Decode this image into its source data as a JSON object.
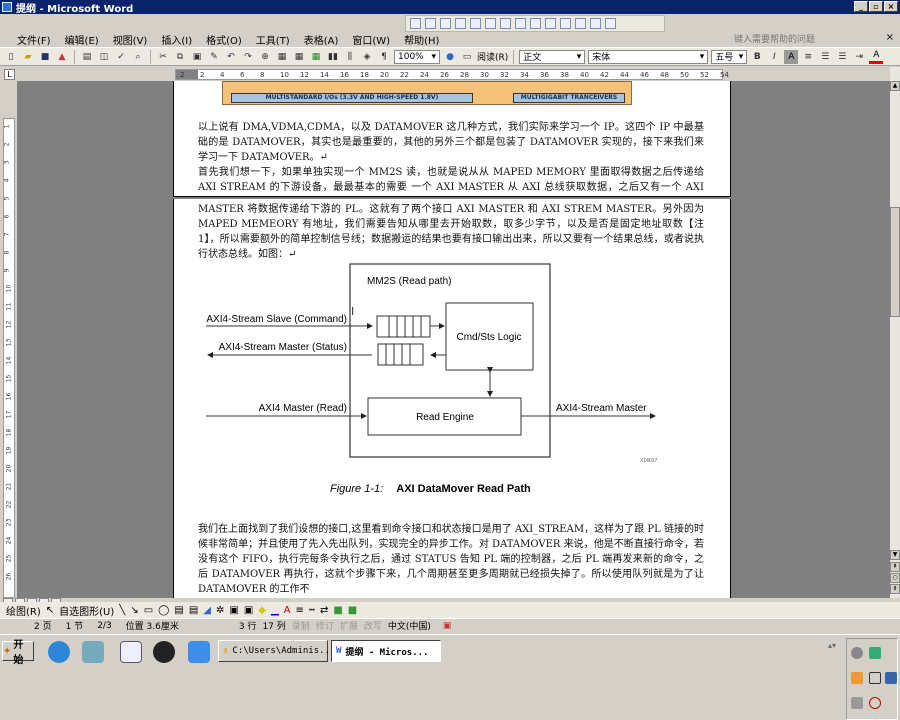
{
  "window": {
    "title": "提纲 - Microsoft Word",
    "minimize": "_",
    "restore": "▫",
    "close": "×"
  },
  "menu": {
    "items": [
      "文件(F)",
      "编辑(E)",
      "视图(V)",
      "插入(I)",
      "格式(O)",
      "工具(T)",
      "表格(A)",
      "窗口(W)",
      "帮助(H)"
    ],
    "help_placeholder": "键入需要帮助的问题",
    "help_close": "×"
  },
  "toolbar": {
    "zoom": "100%",
    "read_label": "阅读(R)",
    "style": "正文",
    "font": "宋体",
    "size": "五号",
    "bold": "B",
    "italic": "I",
    "char_shade": "A",
    "font_color_label": "A"
  },
  "ruler": {
    "ticks": [
      "2",
      "2",
      "4",
      "6",
      "8",
      "10",
      "12",
      "14",
      "16",
      "18",
      "20",
      "22",
      "24",
      "26",
      "28",
      "30",
      "32",
      "34",
      "36",
      "38",
      "40",
      "42",
      "44",
      "46",
      "48",
      "50",
      "52",
      "54"
    ],
    "vticks": [
      "1",
      "2",
      "3",
      "4",
      "5",
      "6",
      "7",
      "8",
      "9",
      "10",
      "11",
      "12",
      "13",
      "14",
      "15",
      "16",
      "17",
      "18",
      "19",
      "20",
      "21",
      "22",
      "23",
      "24",
      "25",
      "26"
    ]
  },
  "banner": {
    "left": "MULTISTANDARD I/Os (3.3V AND HIGH-SPEED 1.8V)",
    "right": "MULTIGIGABIT TRANCEIVERS"
  },
  "document": {
    "p1": "以上说有 DMA,VDMA,CDMA，以及 DATAMOVER 这几种方式，我们实际来学习一个 IP。这四个 IP 中最基础的是 DATAMOVER，其实也是最重要的，其他的另外三个都是包装了 DATAMOVER 实现的，接下来我们来学习一下 DATAMOVER。↵",
    "p2": "首先我们想一下，如果单独实现一个 MM2S 读，也就是说从从 MAPED MEMORY 里面取得数据之后传递给 AXI STREAM 的下游设备，最最基本的需要 一个 AXI MASTER 从 AXI 总线获取数据，之后又有一个 AXI STREAM",
    "p3": "MASTER 将数据传递给下游的 PL。这就有了两个接口 AXI MASTER 和 AXI STREM MASTER。另外因为 MAPED MEMEORY 有地址，我们需要告知从哪里去开始取数，取多少字节，以及是否是固定地址取数【注 1】，所以需要额外的简单控制信号线；数据搬运的结果也要有接口输出出来，所以又要有一个结果总线，或者说执行状态总线。如图：↵",
    "p4": "我们在上面找到了我们设想的接口,这里看到命令接口和状态接口是用了 AXI_STREAM，这样为了跟 PL 链接的时候非常简单；并且使用了先入先出队列，实现完全的异步工作。对 DATAMOVER 来说，他是不断直接行命令，若没有这个 FIFO，执行完每条令执行之后，通过 STATUS 告知 PL 端的控制器，之后 PL 端再发来新的命令，之后 DATAMOVER 再执行，这就个步骤下来，几个周期甚至更多周期就已经损失掉了。所以使用队列就是为了让 DATAMOVER 的工作不"
  },
  "figure": {
    "block_title": "MM2S (Read path)",
    "cmd_logic": "Cmd/Sts Logic",
    "read_engine": "Read Engine",
    "in_cmd": "AXI4-Stream Slave (Command)",
    "out_status": "AXI4-Stream Master (Status)",
    "in_read": "AXI4 Master (Read)",
    "out_stream": "AXI4-Stream Master",
    "figure_id": "X14017",
    "caption_num": "Figure 1-1:",
    "caption_title": "AXI DataMover Read Path"
  },
  "drawbar": {
    "draw": "绘图(R)",
    "autoshapes": "自选图形(U)"
  },
  "status": {
    "page": "2 页",
    "section": "1 节",
    "pages": "2/3",
    "position": "位置 3.6厘米",
    "line": "3 行",
    "col": "17 列",
    "rec": "录制",
    "trk": "修订",
    "ext": "扩展",
    "ovr": "改写",
    "lang": "中文(中国)"
  },
  "taskbar": {
    "start": "开始",
    "explorer": "C:\\Users\\Adminis...",
    "word": "提纲 - Micros..."
  }
}
